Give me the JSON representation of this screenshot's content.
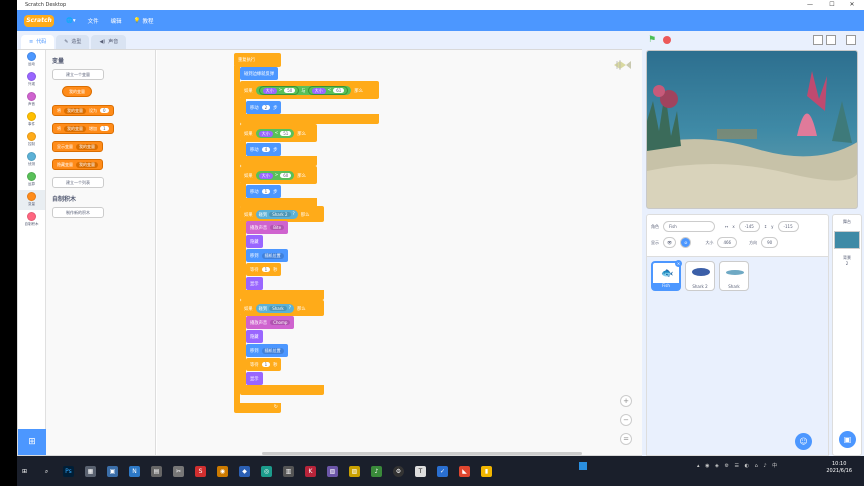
{
  "window": {
    "title": "Scratch Desktop",
    "minimize": "—",
    "maximize": "☐",
    "close": "✕"
  },
  "menubar": {
    "logo": "Scratch",
    "globe": "🌐▾",
    "file": "文件",
    "edit": "编辑",
    "tutorials": "教程"
  },
  "tabs": [
    {
      "label": "代码",
      "icon": "≡"
    },
    {
      "label": "造型",
      "icon": "✎"
    },
    {
      "label": "声音",
      "icon": "◀)"
    }
  ],
  "categories": [
    {
      "label": "运动",
      "color": "#4c97ff"
    },
    {
      "label": "外观",
      "color": "#9966ff"
    },
    {
      "label": "声音",
      "color": "#cf63cf"
    },
    {
      "label": "事件",
      "color": "#ffbf00"
    },
    {
      "label": "控制",
      "color": "#ffab19"
    },
    {
      "label": "侦测",
      "color": "#5cb1d6"
    },
    {
      "label": "运算",
      "color": "#59c059"
    },
    {
      "label": "变量",
      "color": "#ff8c1a"
    },
    {
      "label": "自制积木",
      "color": "#ff6680"
    }
  ],
  "palette": {
    "variables_title": "变量",
    "make_variable": "建立一个变量",
    "my_variable": "我的变量",
    "set_block": {
      "verb": "将",
      "var": "我的变量",
      "to": "设为",
      "value": "0"
    },
    "change_block": {
      "verb": "将",
      "var": "我的变量",
      "by": "增加",
      "value": "1"
    },
    "show_block": {
      "verb": "显示变量",
      "var": "我的变量"
    },
    "hide_block": {
      "verb": "隐藏变量",
      "var": "我的变量"
    },
    "make_list": "建立一个列表",
    "my_blocks_title": "自制积木",
    "make_block": "制作新的积木"
  },
  "script": {
    "forever": "重复执行",
    "bounce": "碰到边缘就反弹",
    "if1": {
      "if": "如果",
      "a": "大小",
      "gt": ">",
      "a_val": "50",
      "and": "与",
      "b": "大小",
      "lt": "<",
      "b_val": "61",
      "then": "那么"
    },
    "move1": {
      "verb": "移动",
      "val": "2",
      "unit": "步"
    },
    "if2": {
      "if": "如果",
      "a": "大小",
      "op": "<",
      "val": "51",
      "then": "那么"
    },
    "move2": {
      "verb": "移动",
      "val": "4",
      "unit": "步"
    },
    "if3": {
      "if": "如果",
      "a": "大小",
      "op": ">",
      "val": "60",
      "then": "那么"
    },
    "move3": {
      "verb": "移动",
      "val": "1",
      "unit": "步"
    },
    "if4": {
      "if": "如果",
      "touch": "碰到",
      "target": "Shark 2",
      "q": "?",
      "then": "那么"
    },
    "play4": {
      "verb": "播放声音",
      "sound": "Bite"
    },
    "hide4": "隐藏",
    "goto4": {
      "verb": "移到",
      "target": "随机位置"
    },
    "wait4": {
      "verb": "等待",
      "val": "1",
      "unit": "秒"
    },
    "show4": "显示",
    "if5": {
      "if": "如果",
      "touch": "碰到",
      "target": "Shark",
      "q": "?",
      "then": "那么"
    },
    "play5": {
      "verb": "播放声音",
      "sound": "Chomp"
    },
    "hide5": "隐藏",
    "goto5": {
      "verb": "移到",
      "target": "随机位置"
    },
    "wait5": {
      "verb": "等待",
      "val": "1",
      "unit": "秒"
    },
    "show5": "显示",
    "loop_arrow": "↻"
  },
  "zoom": {
    "in": "+",
    "out": "−",
    "reset": "="
  },
  "sprite_info": {
    "sprite_label": "角色",
    "sprite_name": "Fish",
    "x_label": "x",
    "x_val": "-145",
    "y_label": "y",
    "y_val": "-115",
    "show_label": "显示",
    "size_label": "大小",
    "size_val": "466",
    "direction_label": "方向",
    "direction_val": "90"
  },
  "sprites": [
    {
      "name": "Fish"
    },
    {
      "name": "Shark 2"
    },
    {
      "name": "Shark"
    }
  ],
  "stage_pane": {
    "title": "舞台",
    "backdrops_label": "背景",
    "backdrops_count": "2"
  },
  "taskbar": {
    "time": "10:10",
    "date": "2021/6/16",
    "icons": [
      "⊞",
      "⌕",
      "Ps",
      "▦",
      "▣",
      "N",
      "▤",
      "✂",
      "S",
      "◉",
      "◆",
      "◎",
      "▥",
      "K",
      "▧",
      "▨",
      "♪",
      "⚙",
      "T",
      "✓",
      "◣",
      "▮"
    ]
  }
}
